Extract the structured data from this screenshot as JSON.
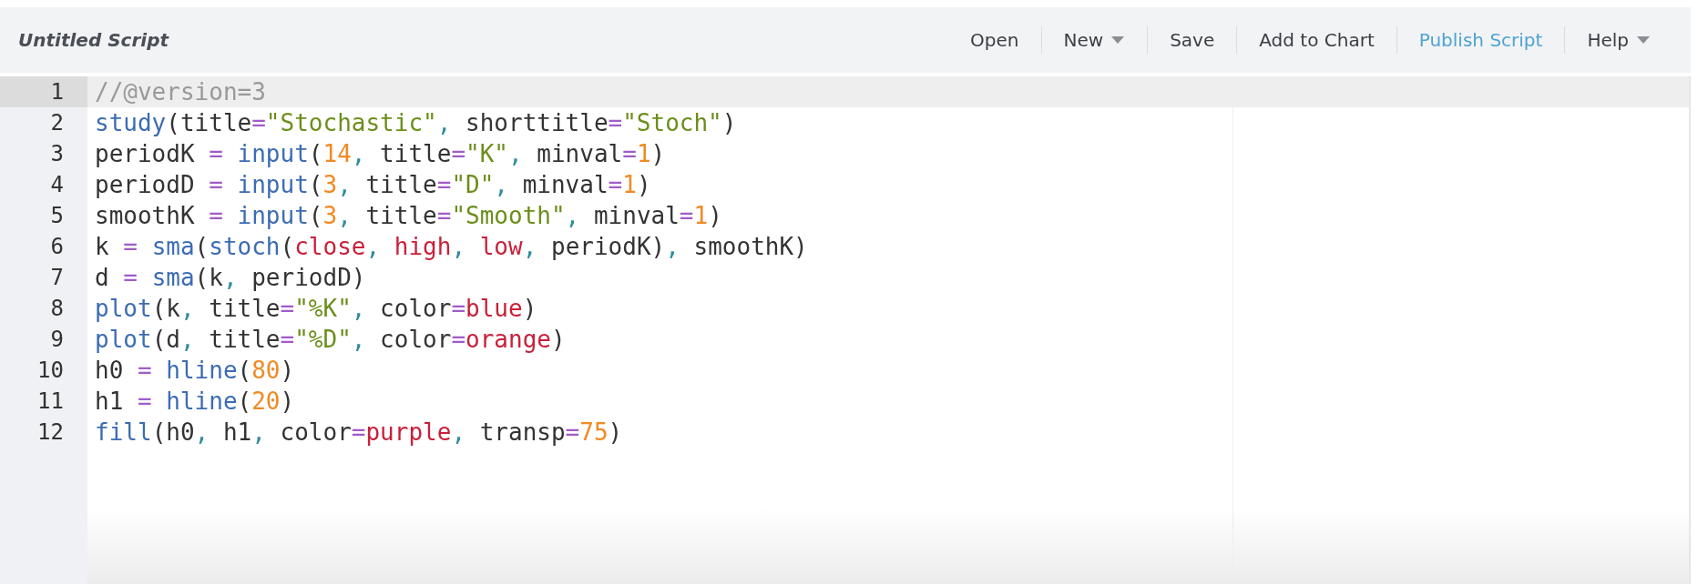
{
  "toolbar": {
    "title": "Untitled Script",
    "buttons": [
      {
        "label": "Open",
        "dropdown": false,
        "accent": false
      },
      {
        "label": "New",
        "dropdown": true,
        "accent": false
      },
      {
        "label": "Save",
        "dropdown": false,
        "accent": false
      },
      {
        "label": "Add to Chart",
        "dropdown": false,
        "accent": false
      },
      {
        "label": "Publish Script",
        "dropdown": false,
        "accent": true
      },
      {
        "label": "Help",
        "dropdown": true,
        "accent": false
      }
    ]
  },
  "editor": {
    "lines": [
      {
        "number": "1",
        "active": true,
        "tokens": [
          {
            "text": "//@version=3",
            "kind": "comment"
          }
        ]
      },
      {
        "number": "2",
        "active": false,
        "tokens": [
          {
            "text": "study",
            "kind": "function"
          },
          {
            "text": "(title",
            "kind": "text"
          },
          {
            "text": "=",
            "kind": "operator"
          },
          {
            "text": "\"Stochastic\"",
            "kind": "string"
          },
          {
            "text": ",",
            "kind": "comma"
          },
          {
            "text": " shorttitle",
            "kind": "text"
          },
          {
            "text": "=",
            "kind": "operator"
          },
          {
            "text": "\"Stoch\"",
            "kind": "string"
          },
          {
            "text": ")",
            "kind": "text"
          }
        ]
      },
      {
        "number": "3",
        "active": false,
        "tokens": [
          {
            "text": "periodK ",
            "kind": "text"
          },
          {
            "text": "= ",
            "kind": "operator"
          },
          {
            "text": "input",
            "kind": "function"
          },
          {
            "text": "(",
            "kind": "text"
          },
          {
            "text": "14",
            "kind": "number"
          },
          {
            "text": ",",
            "kind": "comma"
          },
          {
            "text": " title",
            "kind": "text"
          },
          {
            "text": "=",
            "kind": "operator"
          },
          {
            "text": "\"K\"",
            "kind": "string"
          },
          {
            "text": ",",
            "kind": "comma"
          },
          {
            "text": " minval",
            "kind": "text"
          },
          {
            "text": "=",
            "kind": "operator"
          },
          {
            "text": "1",
            "kind": "number"
          },
          {
            "text": ")",
            "kind": "text"
          }
        ]
      },
      {
        "number": "4",
        "active": false,
        "tokens": [
          {
            "text": "periodD ",
            "kind": "text"
          },
          {
            "text": "= ",
            "kind": "operator"
          },
          {
            "text": "input",
            "kind": "function"
          },
          {
            "text": "(",
            "kind": "text"
          },
          {
            "text": "3",
            "kind": "number"
          },
          {
            "text": ",",
            "kind": "comma"
          },
          {
            "text": " title",
            "kind": "text"
          },
          {
            "text": "=",
            "kind": "operator"
          },
          {
            "text": "\"D\"",
            "kind": "string"
          },
          {
            "text": ",",
            "kind": "comma"
          },
          {
            "text": " minval",
            "kind": "text"
          },
          {
            "text": "=",
            "kind": "operator"
          },
          {
            "text": "1",
            "kind": "number"
          },
          {
            "text": ")",
            "kind": "text"
          }
        ]
      },
      {
        "number": "5",
        "active": false,
        "tokens": [
          {
            "text": "smoothK ",
            "kind": "text"
          },
          {
            "text": "= ",
            "kind": "operator"
          },
          {
            "text": "input",
            "kind": "function"
          },
          {
            "text": "(",
            "kind": "text"
          },
          {
            "text": "3",
            "kind": "number"
          },
          {
            "text": ",",
            "kind": "comma"
          },
          {
            "text": " title",
            "kind": "text"
          },
          {
            "text": "=",
            "kind": "operator"
          },
          {
            "text": "\"Smooth\"",
            "kind": "string"
          },
          {
            "text": ",",
            "kind": "comma"
          },
          {
            "text": " minval",
            "kind": "text"
          },
          {
            "text": "=",
            "kind": "operator"
          },
          {
            "text": "1",
            "kind": "number"
          },
          {
            "text": ")",
            "kind": "text"
          }
        ]
      },
      {
        "number": "6",
        "active": false,
        "tokens": [
          {
            "text": "k ",
            "kind": "text"
          },
          {
            "text": "= ",
            "kind": "operator"
          },
          {
            "text": "sma",
            "kind": "function"
          },
          {
            "text": "(",
            "kind": "text"
          },
          {
            "text": "stoch",
            "kind": "function"
          },
          {
            "text": "(",
            "kind": "text"
          },
          {
            "text": "close",
            "kind": "builtin"
          },
          {
            "text": ", ",
            "kind": "comma"
          },
          {
            "text": "high",
            "kind": "builtin"
          },
          {
            "text": ", ",
            "kind": "comma"
          },
          {
            "text": "low",
            "kind": "builtin"
          },
          {
            "text": ",",
            "kind": "comma"
          },
          {
            "text": " periodK)",
            "kind": "text"
          },
          {
            "text": ",",
            "kind": "comma"
          },
          {
            "text": " smoothK)",
            "kind": "text"
          }
        ]
      },
      {
        "number": "7",
        "active": false,
        "tokens": [
          {
            "text": "d ",
            "kind": "text"
          },
          {
            "text": "= ",
            "kind": "operator"
          },
          {
            "text": "sma",
            "kind": "function"
          },
          {
            "text": "(k",
            "kind": "text"
          },
          {
            "text": ",",
            "kind": "comma"
          },
          {
            "text": " periodD)",
            "kind": "text"
          }
        ]
      },
      {
        "number": "8",
        "active": false,
        "tokens": [
          {
            "text": "plot",
            "kind": "function"
          },
          {
            "text": "(k",
            "kind": "text"
          },
          {
            "text": ",",
            "kind": "comma"
          },
          {
            "text": " title",
            "kind": "text"
          },
          {
            "text": "=",
            "kind": "operator"
          },
          {
            "text": "\"%K\"",
            "kind": "string"
          },
          {
            "text": ",",
            "kind": "comma"
          },
          {
            "text": " color",
            "kind": "text"
          },
          {
            "text": "=",
            "kind": "operator"
          },
          {
            "text": "blue",
            "kind": "builtin"
          },
          {
            "text": ")",
            "kind": "text"
          }
        ]
      },
      {
        "number": "9",
        "active": false,
        "tokens": [
          {
            "text": "plot",
            "kind": "function"
          },
          {
            "text": "(d",
            "kind": "text"
          },
          {
            "text": ",",
            "kind": "comma"
          },
          {
            "text": " title",
            "kind": "text"
          },
          {
            "text": "=",
            "kind": "operator"
          },
          {
            "text": "\"%D\"",
            "kind": "string"
          },
          {
            "text": ",",
            "kind": "comma"
          },
          {
            "text": " color",
            "kind": "text"
          },
          {
            "text": "=",
            "kind": "operator"
          },
          {
            "text": "orange",
            "kind": "builtin"
          },
          {
            "text": ")",
            "kind": "text"
          }
        ]
      },
      {
        "number": "10",
        "active": false,
        "tokens": [
          {
            "text": "h0 ",
            "kind": "text"
          },
          {
            "text": "= ",
            "kind": "operator"
          },
          {
            "text": "hline",
            "kind": "function"
          },
          {
            "text": "(",
            "kind": "text"
          },
          {
            "text": "80",
            "kind": "number"
          },
          {
            "text": ")",
            "kind": "text"
          }
        ]
      },
      {
        "number": "11",
        "active": false,
        "tokens": [
          {
            "text": "h1 ",
            "kind": "text"
          },
          {
            "text": "= ",
            "kind": "operator"
          },
          {
            "text": "hline",
            "kind": "function"
          },
          {
            "text": "(",
            "kind": "text"
          },
          {
            "text": "20",
            "kind": "number"
          },
          {
            "text": ")",
            "kind": "text"
          }
        ]
      },
      {
        "number": "12",
        "active": false,
        "tokens": [
          {
            "text": "fill",
            "kind": "function"
          },
          {
            "text": "(h0",
            "kind": "text"
          },
          {
            "text": ",",
            "kind": "comma"
          },
          {
            "text": " h1",
            "kind": "text"
          },
          {
            "text": ",",
            "kind": "comma"
          },
          {
            "text": " color",
            "kind": "text"
          },
          {
            "text": "=",
            "kind": "operator"
          },
          {
            "text": "purple",
            "kind": "builtin"
          },
          {
            "text": ",",
            "kind": "comma"
          },
          {
            "text": " transp",
            "kind": "text"
          },
          {
            "text": "=",
            "kind": "operator"
          },
          {
            "text": "75",
            "kind": "number"
          },
          {
            "text": ")",
            "kind": "text"
          }
        ]
      }
    ]
  }
}
